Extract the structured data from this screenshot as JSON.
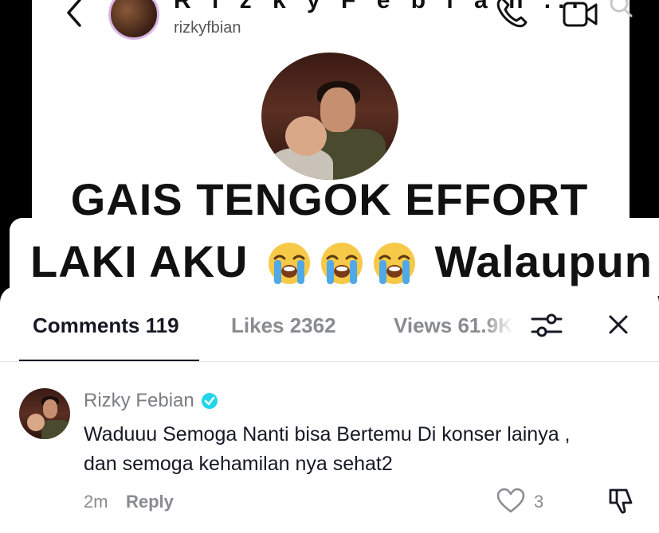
{
  "dm_header": {
    "name": "R i z k y   F e b i a n ...",
    "handle": "rizkyfbian"
  },
  "caption": {
    "line1": "GAIS TENGOK EFFORT",
    "line2_start": "LAKI AKU",
    "line2_end": "Walaupun",
    "emoji": "loudly-crying-face"
  },
  "comments_sheet": {
    "tabs": {
      "comments": "Comments 119",
      "likes": "Likes 2362",
      "views": "Views 61.9K"
    },
    "comment": {
      "author": "Rizky Febian",
      "verified": true,
      "text": "Waduuu Semoga Nanti bisa Bertemu Di konser lainya , dan semoga kehamilan nya sehat2",
      "time": "2m",
      "reply_label": "Reply",
      "like_count": "3"
    }
  },
  "colors": {
    "primary_text": "#161823",
    "secondary_text": "#8a8b91",
    "verified_blue": "#20d5ec",
    "background": "#ffffff"
  }
}
